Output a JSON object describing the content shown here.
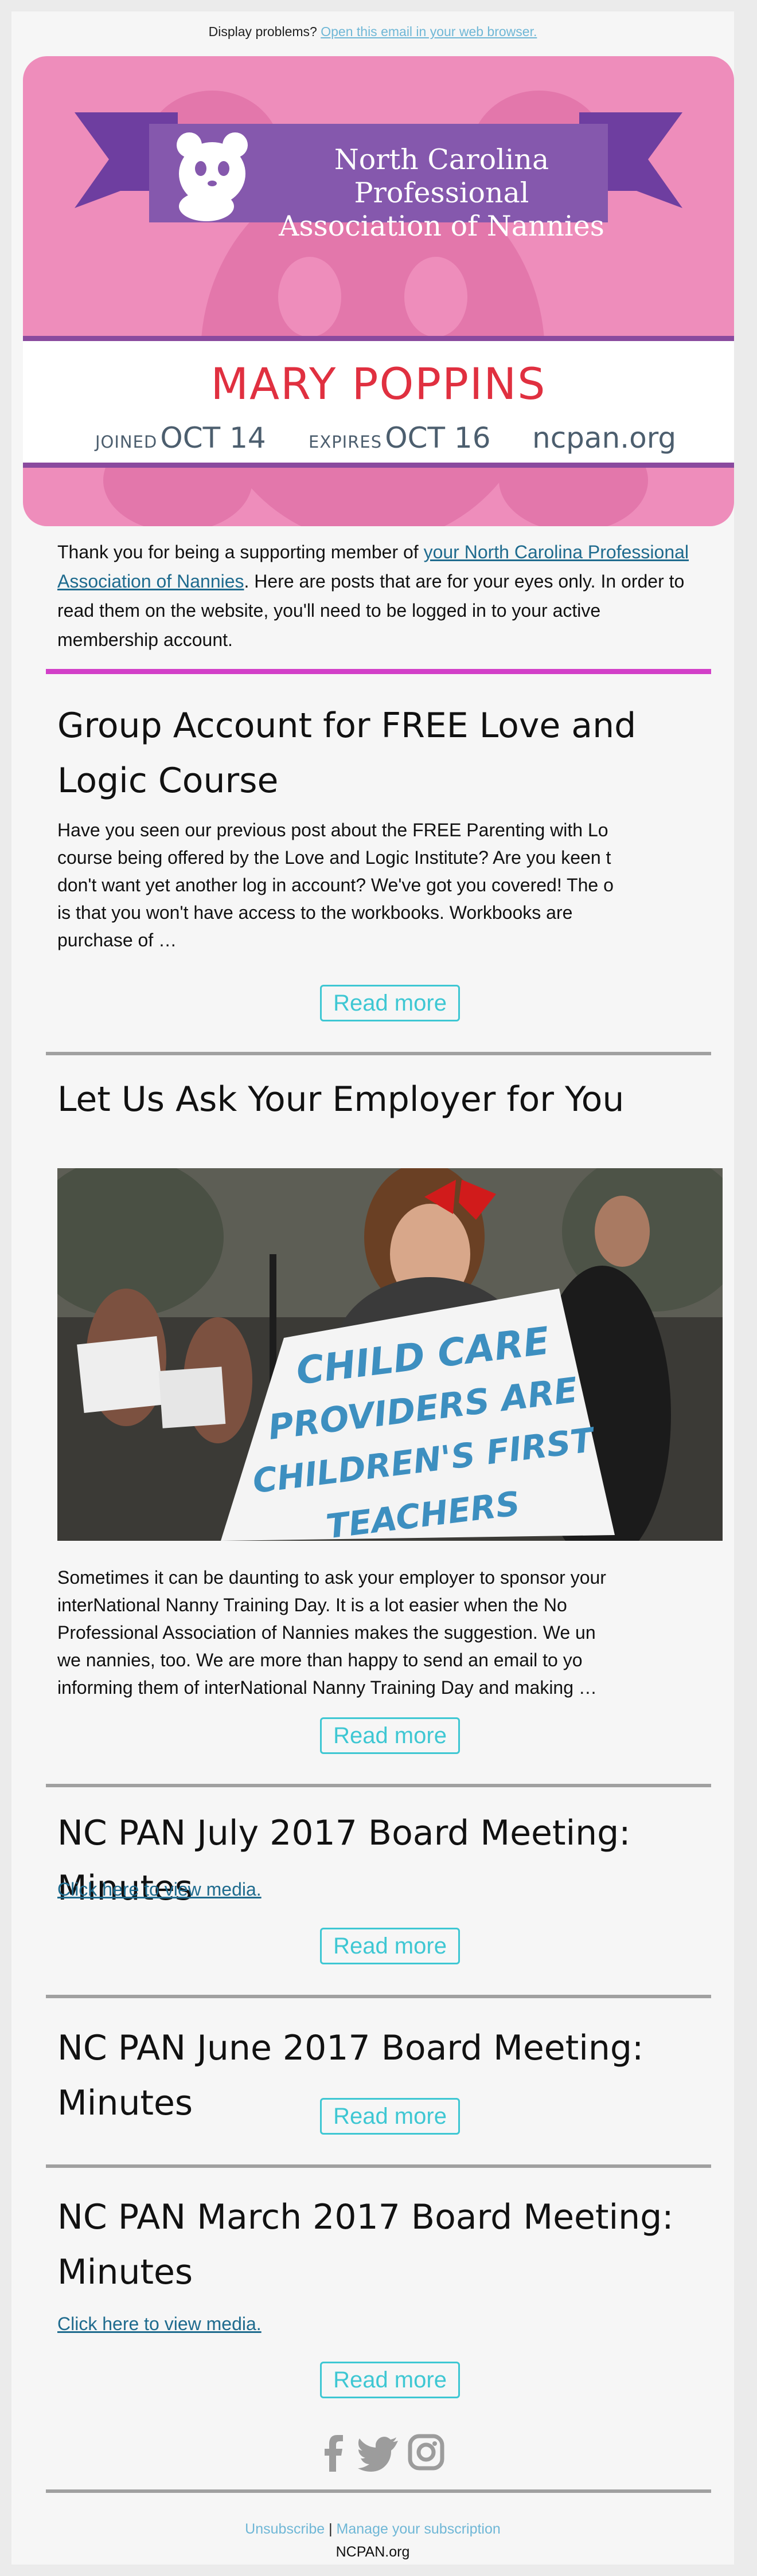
{
  "header": {
    "display_problems": "Display problems?",
    "open_browser_link": "Open this email in your web browser."
  },
  "hero": {
    "org_line1": "North Carolina Professional",
    "org_line2": "Association of Nannies",
    "member_name": "MARY POPPINS",
    "joined_label": "JOINED",
    "joined_value": "OCT 14",
    "expires_label": "EXPIRES",
    "expires_value": "OCT 16",
    "site": "ncpan.org"
  },
  "intro": {
    "before_link": "Thank you for being a supporting member of ",
    "link": "your North Carolina Professional Association of Nannies",
    "after_link": ". Here are posts that are for your eyes only. In order to read them on the website, you'll need to be logged in to your active membership account."
  },
  "posts": [
    {
      "title": "Group Account for FREE Love and Logic Course",
      "excerpt_lines": [
        "Have you seen our previous post about the FREE Parenting with Lo",
        "course being offered by the Love and Logic Institute? Are you keen t",
        "don't want yet another log in account? We've got you covered! The o",
        "is that you won't have access to the workbooks. Workbooks are",
        "purchase of …"
      ],
      "read_more": "Read more"
    },
    {
      "title": "Let Us Ask Your Employer for You",
      "sign_lines": [
        "CHILD CARE",
        "PROVIDERS ARE",
        "CHILDREN'S FIRST",
        "TEACHERS"
      ],
      "excerpt_lines": [
        "Sometimes it can be daunting to ask your employer to sponsor your",
        "interNational Nanny Training Day. It is a lot easier when the No",
        "Professional Association of Nannies makes the suggestion. We un",
        "we nannies, too. We are more than happy to send an email to yo",
        "informing them of interNational Nanny Training Day and making …"
      ],
      "read_more": "Read more"
    },
    {
      "title": "NC PAN July 2017 Board Meeting: Minutes",
      "media_link": "Click here to view media.",
      "read_more": "Read more"
    },
    {
      "title": "NC PAN June 2017 Board Meeting: Minutes",
      "read_more": "Read more"
    },
    {
      "title_line1": "NC PAN March 2017 Board Meeting:",
      "title_line2": "Minutes",
      "media_link": "Click here to view media.",
      "read_more": "Read more"
    }
  ],
  "social": [
    "facebook-icon",
    "twitter-icon",
    "instagram-icon"
  ],
  "footer": {
    "unsubscribe": "Unsubscribe",
    "separator": "|",
    "manage": "Manage your subscription",
    "org": "NCPAN.org"
  },
  "colors": {
    "hero_pink": "#ee8dbb",
    "banner_purple": "#7b4aa6",
    "name_red": "#e03040",
    "accent_cyan": "#3ec7d3",
    "link_blue": "#1f6b8e",
    "rule_pink": "#d23fc8"
  }
}
